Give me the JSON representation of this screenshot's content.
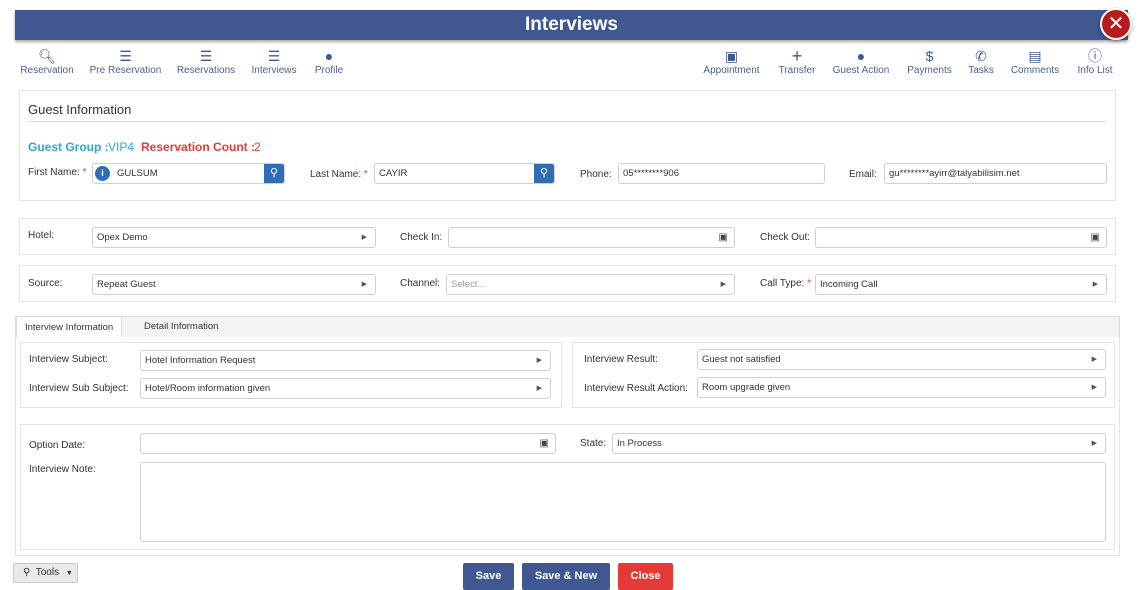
{
  "window": {
    "title": "Interviews",
    "close_icon": "close-icon"
  },
  "toolbar_left": [
    {
      "label": "Reservation",
      "icon": "search-icon"
    },
    {
      "label": "Pre Reservation",
      "icon": "list-icon"
    },
    {
      "label": "Reservations",
      "icon": "ordered-list-icon"
    },
    {
      "label": "Interviews",
      "icon": "list-icon"
    },
    {
      "label": "Profile",
      "icon": "person-icon"
    }
  ],
  "toolbar_right": [
    {
      "label": "Appointment",
      "icon": "calendar-icon"
    },
    {
      "label": "Transfer",
      "icon": "plus-icon"
    },
    {
      "label": "Guest Action",
      "icon": "person-icon"
    },
    {
      "label": "Payments",
      "icon": "dollar-icon"
    },
    {
      "label": "Tasks",
      "icon": "phone-icon"
    },
    {
      "label": "Comments",
      "icon": "comment-icon"
    },
    {
      "label": "Info List",
      "icon": "info-icon"
    }
  ],
  "guest": {
    "title": "Guest Information",
    "group_label": "Guest Group :",
    "group_value": "VIP4",
    "count_label": "Reservation Count :",
    "count_value": "2",
    "first_name_label": "First Name:",
    "first_name": "GULSUM",
    "last_name_label": "Last Name:",
    "last_name": "CAYIR",
    "phone_label": "Phone:",
    "phone": "05********906",
    "email_label": "Email:",
    "email": "gu********ayirr@talyabilisim.net"
  },
  "booking": {
    "hotel_label": "Hotel:",
    "hotel": "Opex Demo",
    "checkin_label": "Check In:",
    "checkin": "",
    "checkout_label": "Check Out:",
    "checkout": "",
    "source_label": "Source:",
    "source": "Repeat Guest",
    "channel_label": "Channel:",
    "channel_placeholder": "Select...",
    "calltype_label": "Call Type:",
    "calltype": "Incoming Call"
  },
  "tabs": [
    "Interview Information",
    "Detail Information"
  ],
  "interview": {
    "subject_label": "Interview Subject:",
    "subject": "Hotel Information Request",
    "subsubject_label": "Interview Sub Subject:",
    "subsubject": "Hotel/Room information given",
    "result_label": "Interview Result:",
    "result": "Guest not satisfied",
    "result_action_label": "Interview Result Action:",
    "result_action": "Room upgrade given",
    "option_date_label": "Option Date:",
    "option_date": "",
    "state_label": "State:",
    "state": "In Process",
    "note_label": "Interview Note:",
    "note": ""
  },
  "footer": {
    "tools": "Tools",
    "save": "Save",
    "save_new": "Save & New",
    "close": "Close"
  },
  "colors": {
    "header": "#3f5891",
    "guest_group": "#29a8e0",
    "reservation_count": "#e53935",
    "close_button": "#e53935"
  }
}
